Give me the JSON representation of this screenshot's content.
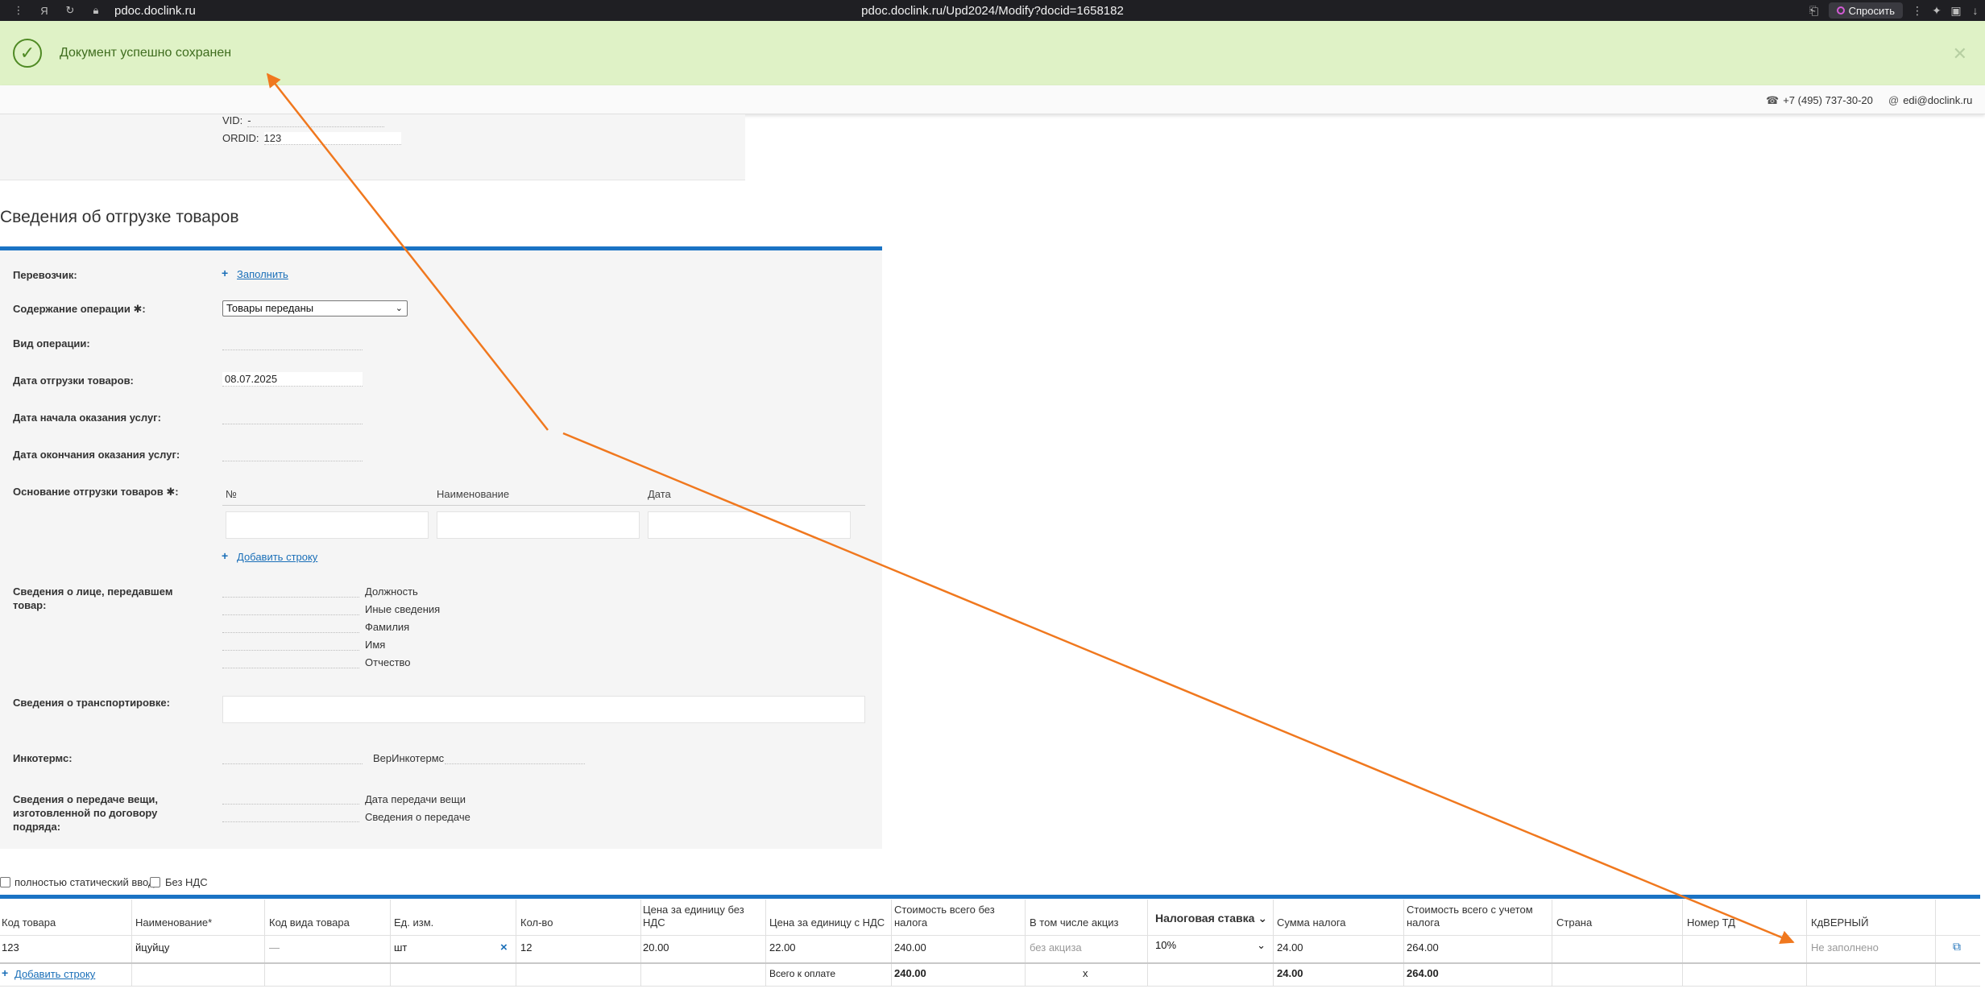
{
  "browser": {
    "host": "pdoc.doclink.ru",
    "url": "pdoc.doclink.ru/Upd2024/Modify?docid=1658182",
    "ask_label": "Спросить"
  },
  "notice": {
    "message": "Документ успешно сохранен"
  },
  "contacts": {
    "phone": "+7 (495) 737-30-20",
    "email": "edi@doclink.ru"
  },
  "top_panel": {
    "vid_label": "VID:",
    "vid_value": "-",
    "ordid_label": "ORDID:",
    "ordid_value": "123"
  },
  "section": {
    "title": "Сведения об отгрузке товаров"
  },
  "form": {
    "carrier_label": "Перевозчик:",
    "carrier_fill_link": "Заполнить",
    "operation_content_label": "Содержание операции ✱:",
    "operation_content_value": "Товары переданы",
    "operation_type_label": "Вид операции:",
    "ship_date_label": "Дата отгрузки товаров:",
    "ship_date_value": "08.07.2025",
    "service_start_label": "Дата начала оказания услуг:",
    "service_end_label": "Дата окончания оказания услуг:",
    "basis_label": "Основание отгрузки товаров ✱:",
    "basis_columns": [
      "№",
      "Наименование",
      "Дата"
    ],
    "add_row_link": "Добавить строку",
    "person_label_1": "Сведения о лице, передавшем",
    "person_label_2": "товар:",
    "person_fields": [
      "Должность",
      "Иные сведения",
      "Фамилия",
      "Имя",
      "Отчество"
    ],
    "transport_label": "Сведения о транспортировке:",
    "incoterms_label": "Инкотермс:",
    "ver_incoterms_label": "ВерИнкотермс",
    "thing_label_1": "Сведения о передаче вещи,",
    "thing_label_2": "изготовленной по договору",
    "thing_label_3": "подряда:",
    "thing_fields": [
      "Дата передачи вещи",
      "Сведения о передаче"
    ]
  },
  "options": {
    "static_input_label": "полностью статический ввод",
    "no_vat_label": "Без НДС"
  },
  "goods_table": {
    "headers": [
      {
        "label": "Код товара"
      },
      {
        "label": "Наименование*"
      },
      {
        "label": "Код вида товара"
      },
      {
        "label": "Ед. изм."
      },
      {
        "label": "Кол-во"
      },
      {
        "label": "Цена за единицу без НДС"
      },
      {
        "label": "Цена за единицу с НДС"
      },
      {
        "label": "Стоимость всего без налога"
      },
      {
        "label": "В том числе акциз"
      },
      {
        "label": "Налоговая ставка"
      },
      {
        "label": "Сумма налога"
      },
      {
        "label": "Стоимость всего с учетом налога"
      },
      {
        "label": "Страна"
      },
      {
        "label": "Номер ТД"
      },
      {
        "label": "КдВЕРНЫЙ"
      }
    ],
    "row": {
      "code": "123",
      "name": "йцуйцу",
      "kind_code": "—",
      "unit": "шт",
      "unit_clear": "×",
      "qty": "12",
      "price_no_vat": "20.00",
      "price_with_vat": "22.00",
      "total_no_tax": "240.00",
      "excise": "без акциза",
      "tax_rate": "10%",
      "tax_sum": "24.00",
      "total_with_tax": "264.00",
      "kd_verny": "Не заполнено"
    },
    "footer": {
      "add_row_link": "Добавить строку",
      "total_label": "Всего к оплате",
      "total_no_tax": "240.00",
      "excise": "x",
      "tax_sum": "24.00",
      "total_with_tax": "264.00"
    }
  },
  "annotation": {
    "arrow_color": "#f0781e"
  }
}
